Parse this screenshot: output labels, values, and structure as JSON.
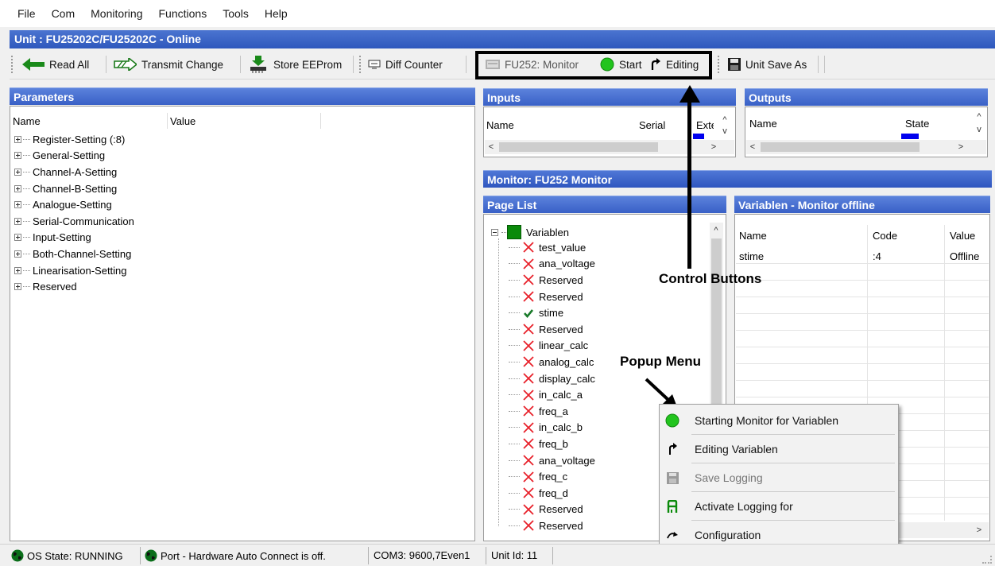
{
  "menu": [
    "File",
    "Com",
    "Monitoring",
    "Functions",
    "Tools",
    "Help"
  ],
  "window_title": "Unit : FU25202C/FU25202C - Online",
  "toolbar": {
    "read_all": "Read All",
    "transmit_change": "Transmit Change",
    "store_eeprom": "Store EEProm",
    "diff_counter": "Diff Counter",
    "monitor_label": "FU252: Monitor",
    "start": "Start",
    "editing": "Editing",
    "unit_save_as": "Unit Save As"
  },
  "parameters": {
    "title": "Parameters",
    "col_name": "Name",
    "col_value": "Value",
    "items": [
      "Register-Setting (:8)",
      "General-Setting",
      "Channel-A-Setting",
      "Channel-B-Setting",
      "Analogue-Setting",
      "Serial-Communication",
      "Input-Setting",
      "Both-Channel-Setting",
      "Linearisation-Setting",
      "Reserved"
    ]
  },
  "inputs": {
    "title": "Inputs",
    "col_name": "Name",
    "col_serial": "Serial",
    "col_extern": "Extern"
  },
  "outputs": {
    "title": "Outputs",
    "col_name": "Name",
    "col_state": "State"
  },
  "monitor": {
    "title": "Monitor: FU252 Monitor"
  },
  "page_list": {
    "title": "Page List",
    "root": "Variablen",
    "items": [
      {
        "name": "test_value",
        "status": "x"
      },
      {
        "name": "ana_voltage",
        "status": "x"
      },
      {
        "name": "Reserved",
        "status": "x"
      },
      {
        "name": "Reserved",
        "status": "x"
      },
      {
        "name": "stime",
        "status": "check"
      },
      {
        "name": "Reserved",
        "status": "x"
      },
      {
        "name": "linear_calc",
        "status": "x"
      },
      {
        "name": "analog_calc",
        "status": "x"
      },
      {
        "name": "display_calc",
        "status": "x"
      },
      {
        "name": "in_calc_a",
        "status": "x"
      },
      {
        "name": "freq_a",
        "status": "x"
      },
      {
        "name": "in_calc_b",
        "status": "x"
      },
      {
        "name": "freq_b",
        "status": "x"
      },
      {
        "name": "ana_voltage",
        "status": "x"
      },
      {
        "name": "freq_c",
        "status": "x"
      },
      {
        "name": "freq_d",
        "status": "x"
      },
      {
        "name": "Reserved",
        "status": "x"
      },
      {
        "name": "Reserved",
        "status": "x"
      }
    ]
  },
  "variablen": {
    "title": "Variablen - Monitor offline",
    "columns": [
      "Name",
      "Code",
      "Value"
    ],
    "rows": [
      {
        "name": "stime",
        "code": ":4",
        "value": "Offline"
      }
    ]
  },
  "popup_menu": {
    "items": [
      {
        "label": "Starting Monitor for Variablen",
        "icon": "green-dot-icon",
        "enabled": true
      },
      {
        "label": "Editing Variablen",
        "icon": "redo-arrow-icon",
        "enabled": true
      },
      {
        "label": "Save Logging",
        "icon": "floppy-disk-icon",
        "enabled": false
      },
      {
        "label": "Activate Logging for",
        "icon": "logging-icon",
        "enabled": true
      },
      {
        "label": "Configuration",
        "icon": "config-arrow-icon",
        "enabled": true
      }
    ]
  },
  "annotations": {
    "control_buttons": "Control Buttons",
    "popup_menu": "Popup Menu"
  },
  "status_bar": {
    "os_state": "OS State: RUNNING",
    "port": "Port - Hardware Auto Connect is off.",
    "com": "COM3: 9600,7Even1",
    "unit_id": "Unit Id: 11"
  },
  "colors": {
    "header_blue": "#3960c6",
    "status_green": "#0a6e1a",
    "start_green": "#22c41e",
    "x_red": "#e8202a"
  }
}
